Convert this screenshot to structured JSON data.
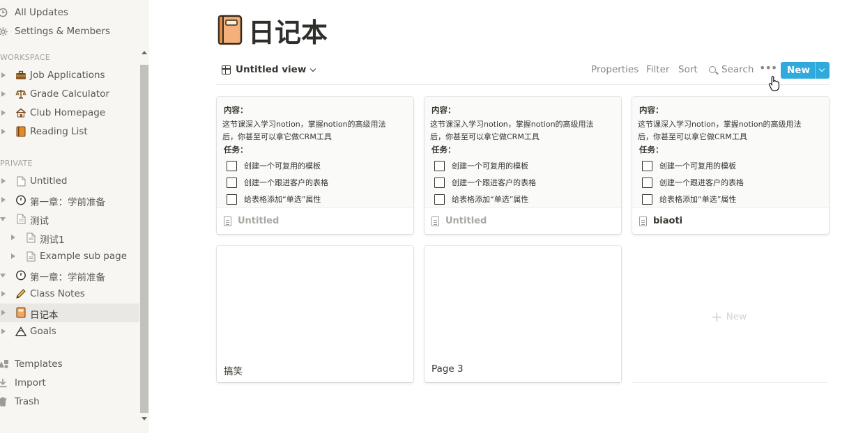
{
  "sidebar": {
    "top_items": [
      {
        "label": "All Updates",
        "icon": "clock-icon"
      },
      {
        "label": "Settings & Members",
        "icon": "gear-icon"
      }
    ],
    "workspace_label": "WORKSPACE",
    "workspace_items": [
      {
        "label": "Job Applications",
        "icon": "briefcase-emoji-icon"
      },
      {
        "label": "Grade Calculator",
        "icon": "scales-emoji-icon"
      },
      {
        "label": "Club Homepage",
        "icon": "house-emoji-icon"
      },
      {
        "label": "Reading List",
        "icon": "book-emoji-icon"
      }
    ],
    "private_label": "PRIVATE",
    "private_items": [
      {
        "label": "Untitled",
        "icon": "doc-icon"
      },
      {
        "label": "第一章：学前准备",
        "icon": "stopwatch-icon"
      },
      {
        "label": "测试",
        "icon": "doc-icon"
      },
      {
        "label": "测试1",
        "icon": "doc-icon"
      },
      {
        "label": "Example sub page",
        "icon": "doc-icon"
      },
      {
        "label": "第一章：学前准备",
        "icon": "stopwatch-icon"
      },
      {
        "label": "Class Notes",
        "icon": "pencil-icon"
      },
      {
        "label": "日记本",
        "icon": "notebook-icon"
      },
      {
        "label": "Goals",
        "icon": "mountain-icon"
      }
    ],
    "bottom_items": [
      {
        "label": "Templates",
        "icon": "templates-icon"
      },
      {
        "label": "Import",
        "icon": "import-icon"
      },
      {
        "label": "Trash",
        "icon": "trash-icon"
      }
    ]
  },
  "page": {
    "title": "日记本",
    "title_icon": "notebook-icon"
  },
  "toolbar": {
    "view_name": "Untitled view",
    "properties": "Properties",
    "filter": "Filter",
    "sort": "Sort",
    "search": "Search",
    "more": "•••",
    "new_label": "New"
  },
  "preview": {
    "content_heading": "内容：",
    "content_line1": "这节课深入学习notion，掌握notion的高级用法",
    "content_line2": "后，你甚至可以拿它做CRM工具",
    "tasks_heading": "任务：",
    "tasks": [
      "创建一个可复用的模板",
      "创建一个跟进客户的表格",
      "给表格添加“单选”属性"
    ]
  },
  "cards": [
    {
      "title": "Untitled"
    },
    {
      "title": "Untitled"
    },
    {
      "title": "biaoti"
    },
    {
      "title": "搞笑"
    },
    {
      "title": "Page 3"
    }
  ],
  "new_card_label": "New",
  "colors": {
    "accent": "#2eaadc",
    "sidebar_bg": "#f7f6f3",
    "text": "#37352f"
  }
}
